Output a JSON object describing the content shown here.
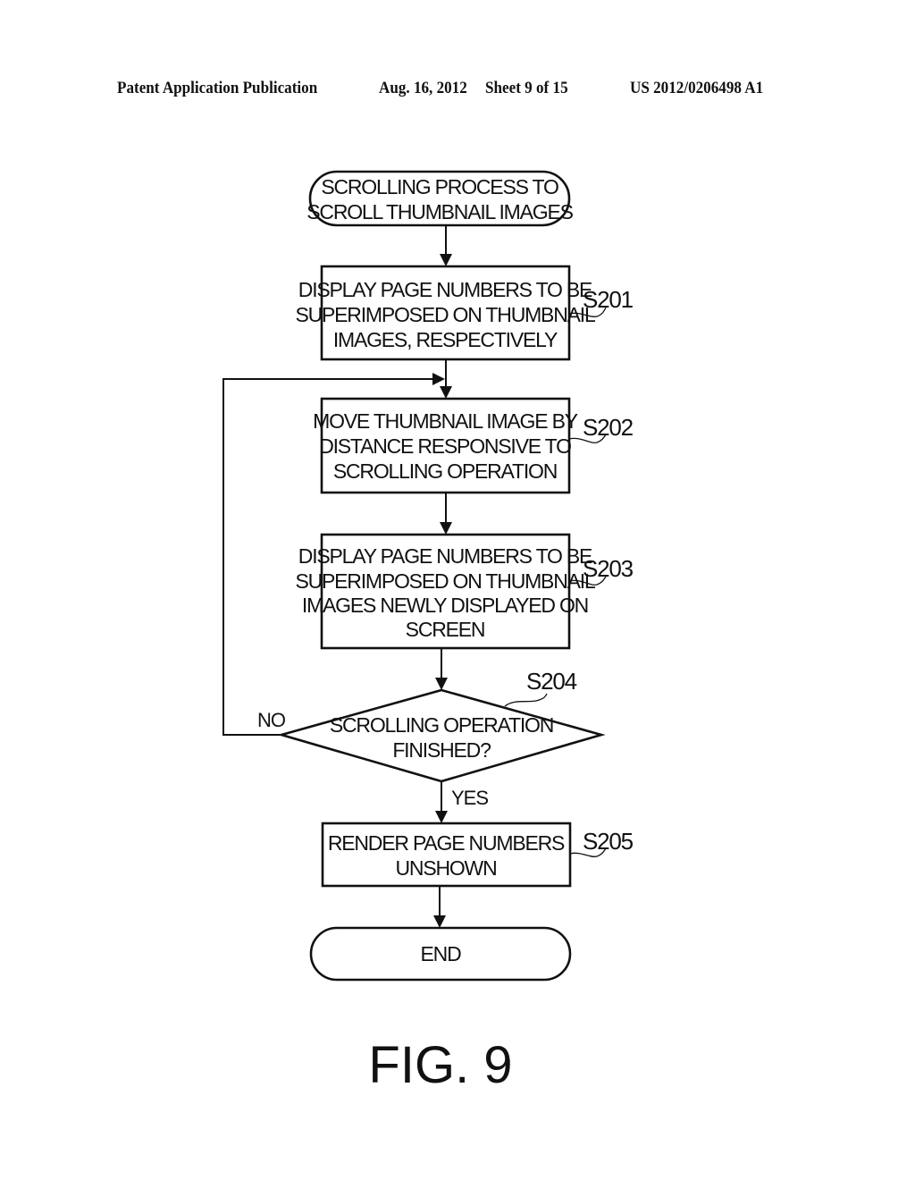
{
  "header": {
    "publication": "Patent Application Publication",
    "date": "Aug. 16, 2012",
    "sheet": "Sheet 9 of 15",
    "number": "US 2012/0206498 A1"
  },
  "flowchart": {
    "start": {
      "lines": [
        "SCROLLING PROCESS TO",
        "SCROLL THUMBNAIL IMAGES"
      ]
    },
    "steps": [
      {
        "id": "S201",
        "lines": [
          "DISPLAY PAGE NUMBERS TO BE",
          "SUPERIMPOSED ON THUMBNAIL",
          "IMAGES, RESPECTIVELY"
        ]
      },
      {
        "id": "S202",
        "lines": [
          "MOVE THUMBNAIL IMAGE BY",
          "DISTANCE RESPONSIVE TO",
          "SCROLLING OPERATION"
        ]
      },
      {
        "id": "S203",
        "lines": [
          "DISPLAY PAGE NUMBERS TO BE",
          "SUPERIMPOSED ON THUMBNAIL",
          "IMAGES NEWLY DISPLAYED ON",
          "SCREEN"
        ]
      }
    ],
    "decision": {
      "id": "S204",
      "lines": [
        "SCROLLING OPERATION",
        "FINISHED?"
      ],
      "no_label": "NO",
      "yes_label": "YES"
    },
    "final_step": {
      "id": "S205",
      "lines": [
        "RENDER PAGE NUMBERS",
        "UNSHOWN"
      ]
    },
    "end": {
      "label": "END"
    }
  },
  "figure_label": "FIG. 9"
}
